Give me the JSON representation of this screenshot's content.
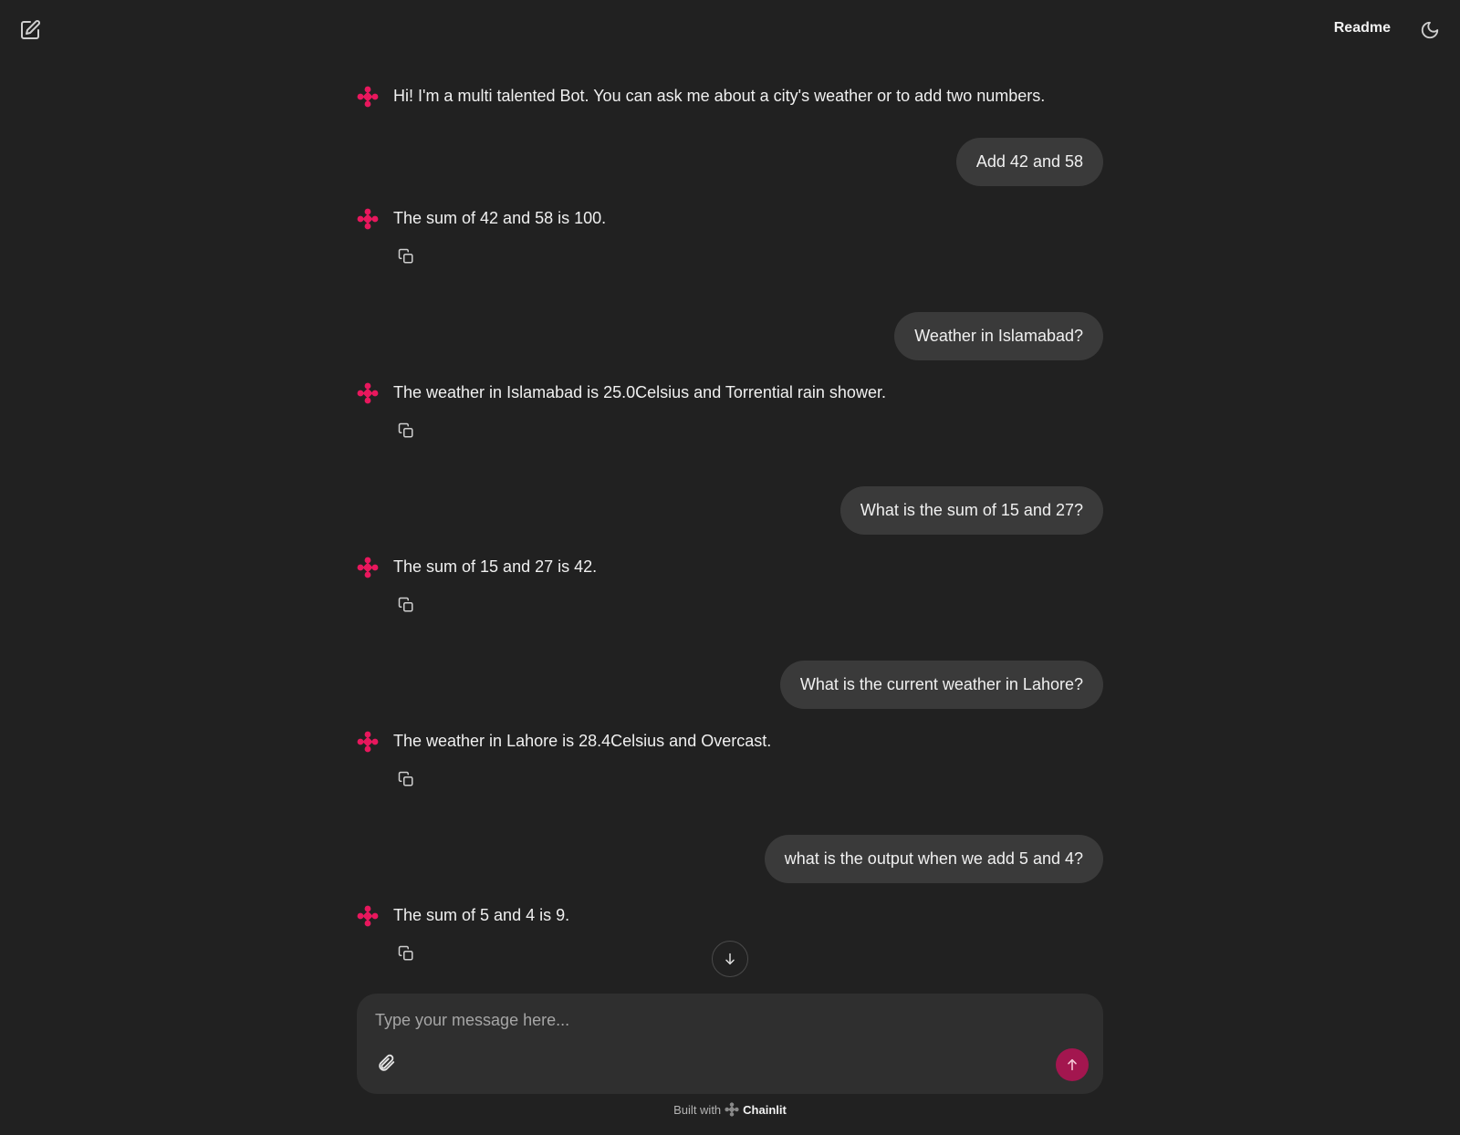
{
  "header": {
    "readme_label": "Readme",
    "new_chat_icon": "edit-icon",
    "theme_icon": "moon-icon"
  },
  "thread": [
    {
      "role": "bot",
      "text": "Hi! I'm a multi talented Bot. You can ask me about a city's weather or to add two numbers.",
      "copy": false
    },
    {
      "role": "user",
      "text": "Add 42 and 58"
    },
    {
      "role": "bot",
      "text": "The sum of 42 and 58 is 100.",
      "copy": true
    },
    {
      "role": "user",
      "text": "Weather in Islamabad?"
    },
    {
      "role": "bot",
      "text": "The weather in Islamabad is 25.0Celsius and Torrential rain shower.",
      "copy": true
    },
    {
      "role": "user",
      "text": "What is the sum of 15 and 27?"
    },
    {
      "role": "bot",
      "text": "The sum of 15 and 27 is 42.",
      "copy": true
    },
    {
      "role": "user",
      "text": "What is the current weather in Lahore?"
    },
    {
      "role": "bot",
      "text": "The weather in Lahore is 28.4Celsius and Overcast.",
      "copy": true
    },
    {
      "role": "user",
      "text": "what is the output when we add 5 and 4?"
    },
    {
      "role": "bot",
      "text": "The sum of 5 and 4 is 9.",
      "copy": true
    }
  ],
  "composer": {
    "placeholder": "Type your message here...",
    "value": ""
  },
  "footer": {
    "built_with": "Built with",
    "brand": "Chainlit"
  },
  "colors": {
    "background": "#212121",
    "bubble": "#3a3a3a",
    "composer": "#2f2f2f",
    "accent": "#e8175d",
    "send": "#a3164f"
  }
}
